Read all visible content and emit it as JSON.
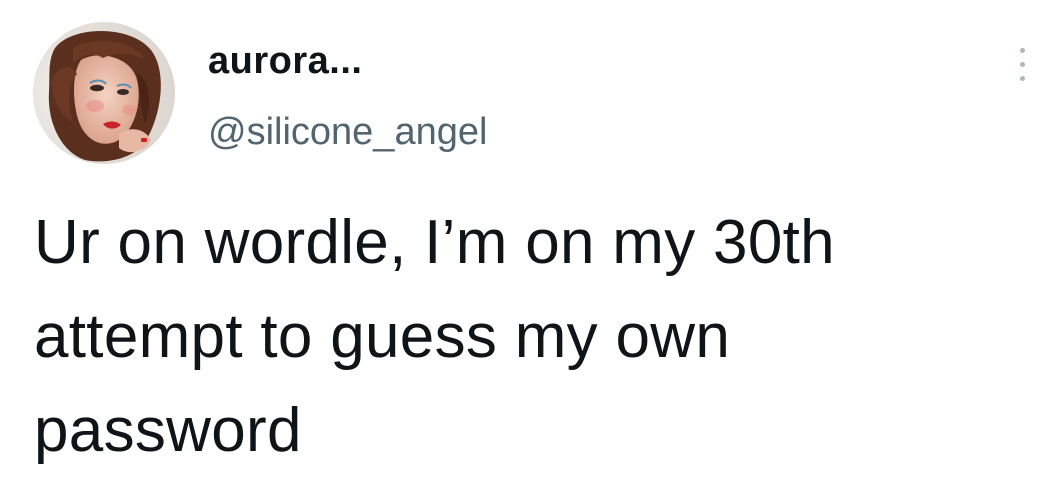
{
  "author": {
    "display_name": "aurora...",
    "handle": "@silicone_angel",
    "avatar_icon": "profile-photo"
  },
  "menu": {
    "icon": "more-vertical-icon"
  },
  "tweet": {
    "lines": [
      "Ur on wordle, I’m on my 30th",
      "attempt to guess my own",
      "password"
    ]
  },
  "colors": {
    "text": "#0f1419",
    "handle": "#536471",
    "menu_dots": "#aab8c2",
    "background": "#ffffff"
  }
}
